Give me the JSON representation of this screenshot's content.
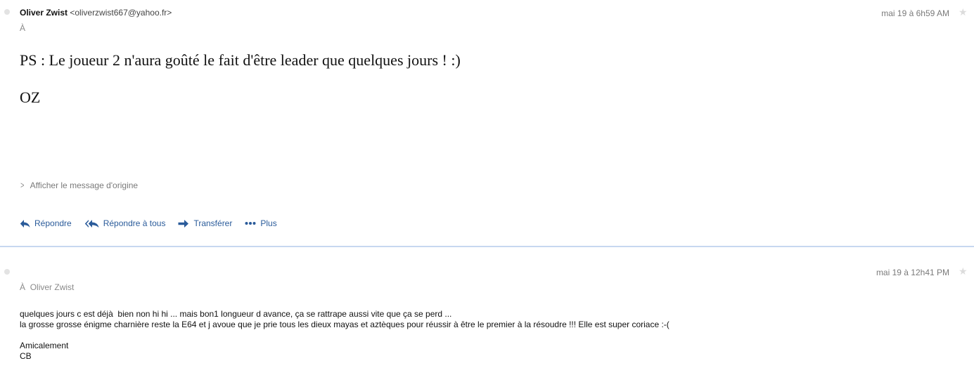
{
  "message1": {
    "sender_name": "Oliver Zwist",
    "sender_email": "<oliverzwist667@yahoo.fr>",
    "date": "mai 19 à 6h59 AM",
    "to_label": "À",
    "body_lines": [
      "PS : Le joueur 2 n'aura goûté le fait d'être leader que quelques jours ! :)",
      "OZ"
    ],
    "show_original": "Afficher le message d'origine",
    "actions": {
      "reply": "Répondre",
      "reply_all": "Répondre à tous",
      "forward": "Transférer",
      "more": "Plus"
    }
  },
  "message2": {
    "date": "mai 19 à 12h41 PM",
    "to_label": "À",
    "to_name": "Oliver Zwist",
    "body_lines": [
      "quelques jours c est déjà  bien non hi hi ... mais bon1 longueur d avance, ça se rattrape aussi vite que ça se perd ...",
      "la grosse grosse énigme charnière reste la E64 et j avoue que je prie tous les dieux mayas et aztèques pour réussir à être le premier à la résoudre !!! Elle est super coriace :-(",
      "",
      "Amicalement",
      "CB"
    ]
  },
  "icons": {
    "unread_dot": "dot-icon",
    "star": "star-icon",
    "reply": "reply-arrow-icon",
    "reply_all": "reply-all-arrow-icon",
    "forward": "forward-arrow-icon",
    "more": "ellipsis-icon",
    "expand": "chevron-right-icon"
  },
  "colors": {
    "action_link": "#2a5b9a",
    "divider": "#c7d8f0",
    "muted_text": "#7a7a7a"
  }
}
